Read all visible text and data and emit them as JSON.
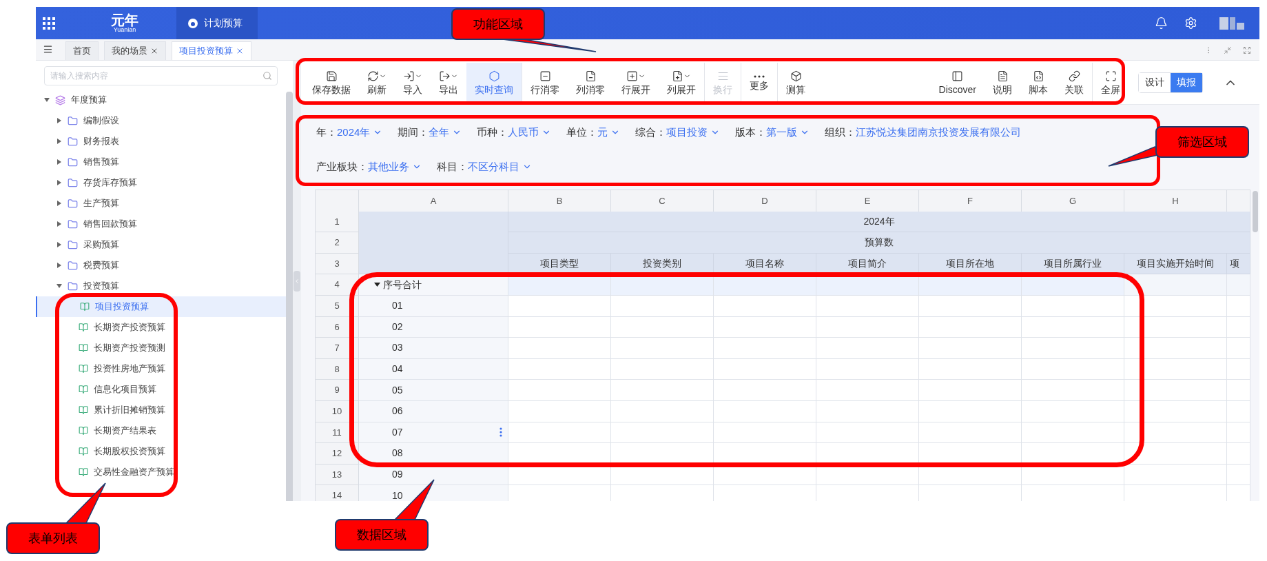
{
  "top_bar": {
    "logo": "元年",
    "logo_sub": "Yuanian",
    "app_tab": "计划预算"
  },
  "tabs": [
    {
      "label": "首页",
      "closable": false,
      "selected": false
    },
    {
      "label": "我的场景",
      "closable": true,
      "selected": false
    },
    {
      "label": "项目投资预算",
      "closable": true,
      "selected": true
    }
  ],
  "sidebar": {
    "search": {
      "placeholder": "请输入搜索内容"
    },
    "tree": [
      {
        "label": "年度预算",
        "kind": "group",
        "expanded": true,
        "selected": false,
        "children": [
          {
            "label": "编制假设",
            "kind": "folder",
            "expanded": false,
            "selected": false
          },
          {
            "label": "财务报表",
            "kind": "folder",
            "expanded": false,
            "selected": false
          },
          {
            "label": "销售预算",
            "kind": "folder",
            "expanded": false,
            "selected": false
          },
          {
            "label": "存货库存预算",
            "kind": "folder",
            "expanded": false,
            "selected": false
          },
          {
            "label": "生产预算",
            "kind": "folder",
            "expanded": false,
            "selected": false
          },
          {
            "label": "销售回款预算",
            "kind": "folder",
            "expanded": false,
            "selected": false
          },
          {
            "label": "采购预算",
            "kind": "folder",
            "expanded": false,
            "selected": false
          },
          {
            "label": "税费预算",
            "kind": "folder",
            "expanded": false,
            "selected": false
          },
          {
            "label": "投资预算",
            "kind": "folder",
            "expanded": true,
            "selected": false,
            "children": [
              {
                "label": "项目投资预算",
                "kind": "form",
                "selected": true
              },
              {
                "label": "长期资产投资预算",
                "kind": "form",
                "selected": false
              },
              {
                "label": "长期资产投资预测",
                "kind": "form",
                "selected": false
              },
              {
                "label": "投资性房地产预算",
                "kind": "form",
                "selected": false
              },
              {
                "label": "信息化项目预算",
                "kind": "form",
                "selected": false
              },
              {
                "label": "累计折旧摊销预算",
                "kind": "form",
                "selected": false
              },
              {
                "label": "长期资产结果表",
                "kind": "form",
                "selected": false
              },
              {
                "label": "长期股权投资预算",
                "kind": "form",
                "selected": false
              },
              {
                "label": "交易性金融资产预算",
                "kind": "form",
                "selected": false
              }
            ]
          }
        ]
      }
    ]
  },
  "toolbar": {
    "left_groups": [
      [
        {
          "label": "保存数据",
          "dropdown": false,
          "selected": false,
          "disabled": false
        },
        {
          "label": "刷新",
          "dropdown": true,
          "selected": false,
          "disabled": false
        },
        {
          "label": "导入",
          "dropdown": true,
          "selected": false,
          "disabled": false
        },
        {
          "label": "导出",
          "dropdown": true,
          "selected": false,
          "disabled": false
        },
        {
          "label": "实时查询",
          "dropdown": false,
          "selected": true,
          "disabled": false
        }
      ],
      [
        {
          "label": "行消零",
          "dropdown": false,
          "selected": false,
          "disabled": false
        },
        {
          "label": "列消零",
          "dropdown": false,
          "selected": false,
          "disabled": false
        },
        {
          "label": "行展开",
          "dropdown": true,
          "selected": false,
          "disabled": false
        },
        {
          "label": "列展开",
          "dropdown": true,
          "selected": false,
          "disabled": false
        }
      ],
      [
        {
          "label": "换行",
          "dropdown": false,
          "selected": false,
          "disabled": true
        }
      ],
      [
        {
          "label": "更多",
          "dropdown": false,
          "selected": false,
          "disabled": false
        }
      ],
      [
        {
          "label": "测算",
          "dropdown": false,
          "selected": false,
          "disabled": false
        }
      ]
    ],
    "right_groups": [
      [
        {
          "label": "Discover",
          "dropdown": false,
          "selected": false,
          "disabled": false
        },
        {
          "label": "说明",
          "dropdown": false,
          "selected": false,
          "disabled": false
        },
        {
          "label": "脚本",
          "dropdown": false,
          "selected": false,
          "disabled": false
        },
        {
          "label": "关联",
          "dropdown": false,
          "selected": false,
          "disabled": false
        }
      ],
      [
        {
          "label": "全屏",
          "dropdown": false,
          "selected": false,
          "disabled": false
        }
      ]
    ],
    "mode_toggle": [
      {
        "label": "设计",
        "selected": false
      },
      {
        "label": "填报",
        "selected": true
      }
    ]
  },
  "filters": [
    [
      {
        "label": "年：",
        "value": "2024年",
        "dropdown": true
      },
      {
        "label": "期间：",
        "value": "全年",
        "dropdown": true
      },
      {
        "label": "币种：",
        "value": "人民币",
        "dropdown": true
      },
      {
        "label": "单位：",
        "value": "元",
        "dropdown": true
      },
      {
        "label": "综合：",
        "value": "项目投资",
        "dropdown": true
      },
      {
        "label": "版本：",
        "value": "第一版",
        "dropdown": true
      },
      {
        "label": "组织：",
        "value": "江苏悦达集团南京投资发展有限公司",
        "dropdown": false
      }
    ],
    [
      {
        "label": "产业板块：",
        "value": "其他业务",
        "dropdown": true
      },
      {
        "label": "科目：",
        "value": "不区分科目",
        "dropdown": true
      }
    ]
  ],
  "grid": {
    "column_letters": [
      "A",
      "B",
      "C",
      "D",
      "E",
      "F",
      "G",
      "H"
    ],
    "row_numbers": [
      "1",
      "2",
      "3",
      "4",
      "5",
      "6",
      "7",
      "8",
      "9",
      "10",
      "11",
      "12",
      "13",
      "14"
    ],
    "year_header": "2024年",
    "measure_header": "预算数",
    "field_headers": [
      "项目类型",
      "投资类别",
      "项目名称",
      "项目简介",
      "项目所在地",
      "项目所属行业",
      "项目实施开始时间",
      "项"
    ],
    "total_row": {
      "label": "序号合计",
      "expanded": true
    },
    "row_labels": [
      "01",
      "02",
      "03",
      "04",
      "05",
      "06",
      "07",
      "08",
      "09",
      "10"
    ]
  },
  "annotations": [
    {
      "text": "功能区域"
    },
    {
      "text": "筛选区域"
    },
    {
      "text": "表单列表"
    },
    {
      "text": "数据区域"
    }
  ]
}
